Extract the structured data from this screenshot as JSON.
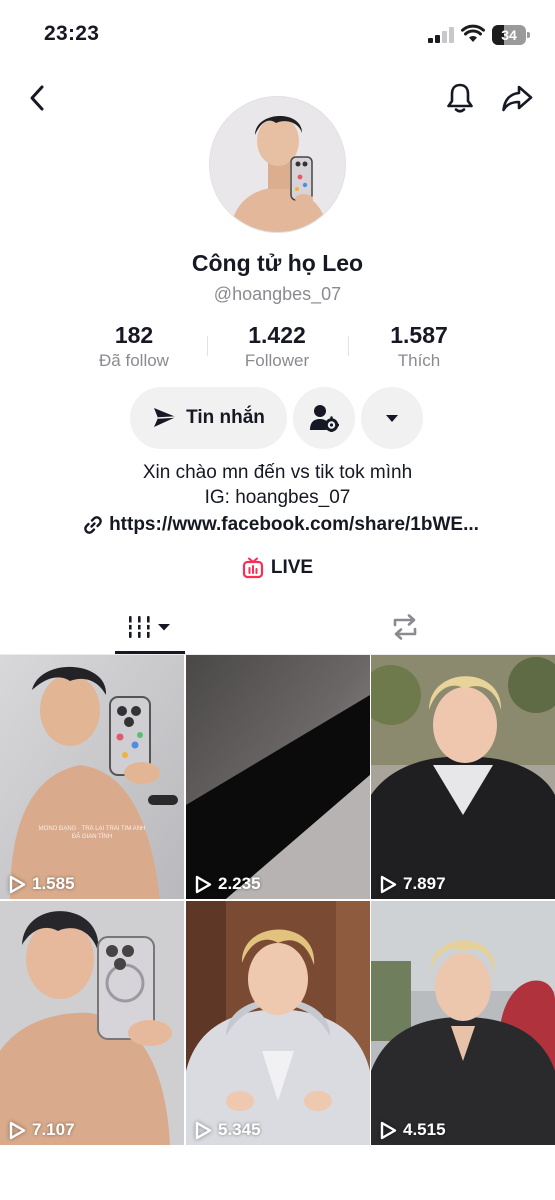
{
  "status_bar": {
    "time": "23:23",
    "battery": "34",
    "battery_level": 0.34
  },
  "profile": {
    "display_name": "Công tử họ Leo",
    "username": "@hoangbes_07",
    "stats": [
      {
        "value": "182",
        "label": "Đã follow"
      },
      {
        "value": "1.422",
        "label": "Follower"
      },
      {
        "value": "1.587",
        "label": "Thích"
      }
    ],
    "message_label": "Tin nhắn",
    "bio_lines": [
      "Xin chào mn đến vs tik tok mình",
      "IG: hoangbes_07"
    ],
    "link": "https://www.facebook.com/share/1bWE...",
    "live_label": "LIVE"
  },
  "icons": {
    "back": "chevron-left-icon",
    "bell": "bell-icon",
    "share": "share-arrow-icon",
    "message": "paper-plane-icon",
    "add_friend": "person-gear-icon",
    "more": "caret-down-icon",
    "link": "link-icon",
    "live": "tv-icon",
    "tab_videos": "grid-bars-icon",
    "tab_reposts": "repost-icon",
    "play": "play-icon"
  },
  "colors": {
    "accent_live": "#fe2c55",
    "text_primary": "#161823",
    "text_secondary": "#8a8b91",
    "button_bg": "#f1f1f2"
  },
  "videos": [
    {
      "views": "1.585",
      "caption": "MONO ĐẶNG · TRẢ LẠI TRÁI TIM ANH ĐÃ GIAN TÌNH"
    },
    {
      "views": "2.235",
      "caption": ""
    },
    {
      "views": "7.897",
      "caption": ""
    },
    {
      "views": "7.107",
      "caption": ""
    },
    {
      "views": "5.345",
      "caption": ""
    },
    {
      "views": "4.515",
      "caption": ""
    }
  ]
}
